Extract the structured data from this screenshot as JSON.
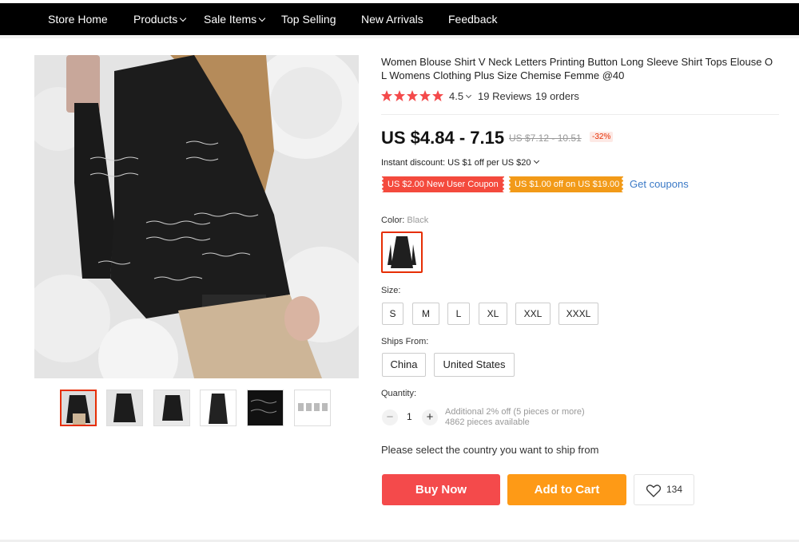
{
  "nav": {
    "items": [
      {
        "label": "Store Home",
        "dropdown": false
      },
      {
        "label": "Products",
        "dropdown": true
      },
      {
        "label": "Sale Items",
        "dropdown": true
      },
      {
        "label": "Top Selling",
        "dropdown": false
      },
      {
        "label": "New Arrivals",
        "dropdown": false
      },
      {
        "label": "Feedback",
        "dropdown": false
      }
    ]
  },
  "product": {
    "title": "Women Blouse Shirt V Neck Letters Printing Button Long Sleeve Shirt Tops Elouse O L Womens Clothing Plus Size Chemise Femme @40",
    "rating": "4.5",
    "reviews": "19 Reviews",
    "orders": "19 orders",
    "price": "US $4.84 - 7.15",
    "old_price": "US $7.12 - 10.51",
    "discount": "-32%",
    "instant_discount": "Instant discount: US $1 off per US $20",
    "coupons": {
      "new_user": "US $2.00 New User Coupon",
      "store": "US $1.00 off on US $19.00",
      "get_label": "Get coupons"
    },
    "color_label": "Color:",
    "color_value": "Black",
    "size_label": "Size:",
    "sizes": [
      "S",
      "M",
      "L",
      "XL",
      "XXL",
      "XXXL"
    ],
    "ships_label": "Ships From:",
    "ships_from": [
      "China",
      "United States"
    ],
    "quantity_label": "Quantity:",
    "quantity": "1",
    "qty_minus": "−",
    "qty_plus": "+",
    "qty_note_1": "Additional 2% off (5 pieces or more)",
    "qty_note_2": "4862 pieces available",
    "ship_message": "Please select the country you want to ship from",
    "buy_now": "Buy Now",
    "add_to_cart": "Add to Cart",
    "wishlist_count": "134"
  },
  "colors": {
    "accent_red": "#f44a4b",
    "accent_orange": "#fe9a16",
    "link_blue": "#3a79c6",
    "star": "#f44a4b"
  }
}
